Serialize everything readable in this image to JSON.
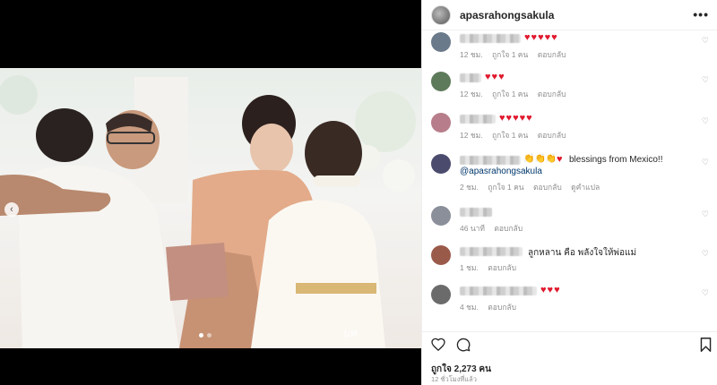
{
  "post": {
    "username": "apasrahongsakula",
    "watermark": "บห",
    "carousel": {
      "slides": 2,
      "active": 1
    }
  },
  "comments": [
    {
      "text": "",
      "hearts": "♥♥♥♥♥",
      "time": "12 ชม.",
      "likes": "ถูกใจ 1 คน",
      "reply": "ตอบกลับ",
      "avatar_color": "#6a7a8a"
    },
    {
      "text": "",
      "hearts": "♥♥♥",
      "time": "12 ชม.",
      "likes": "ถูกใจ 1 คน",
      "reply": "ตอบกลับ",
      "avatar_color": "#5d7a5a"
    },
    {
      "text": "",
      "hearts": "♥♥♥♥♥",
      "time": "12 ชม.",
      "likes": "ถูกใจ 1 คน",
      "reply": "ตอบกลับ",
      "avatar_color": "#b77d8a"
    },
    {
      "text": "blessings from Mexico!!",
      "emoji": "👏👏👏",
      "hearts": "♥",
      "mention": "@apasrahongsakula",
      "time": "2 ชม.",
      "likes": "ถูกใจ 1 คน",
      "reply": "ตอบกลับ",
      "translate": "ดูคำแปล",
      "avatar_color": "#4b4b6e"
    },
    {
      "text": "",
      "hearts": "",
      "time": "46 นาที",
      "likes": "",
      "reply": "ตอบกลับ",
      "avatar_color": "#8a8f99"
    },
    {
      "text": "ลูกหลาน คือ พลังใจให้พ่อแม่",
      "hearts": "",
      "time": "1 ชม.",
      "likes": "",
      "reply": "ตอบกลับ",
      "avatar_color": "#9a5a4a"
    },
    {
      "text": "",
      "hearts": "♥♥♥",
      "time": "4 ชม.",
      "likes": "",
      "reply": "ตอบกลับ",
      "avatar_color": "#6b6b6b"
    }
  ],
  "footer": {
    "likes": "ถูกใจ 2,273 คน",
    "time_ago": "12 ชั่วโมงที่แล้ว"
  },
  "icons": {
    "more": "more-options-icon",
    "like": "heart-icon",
    "comment": "comment-icon",
    "save": "bookmark-icon",
    "prev": "chevron-left-icon"
  }
}
